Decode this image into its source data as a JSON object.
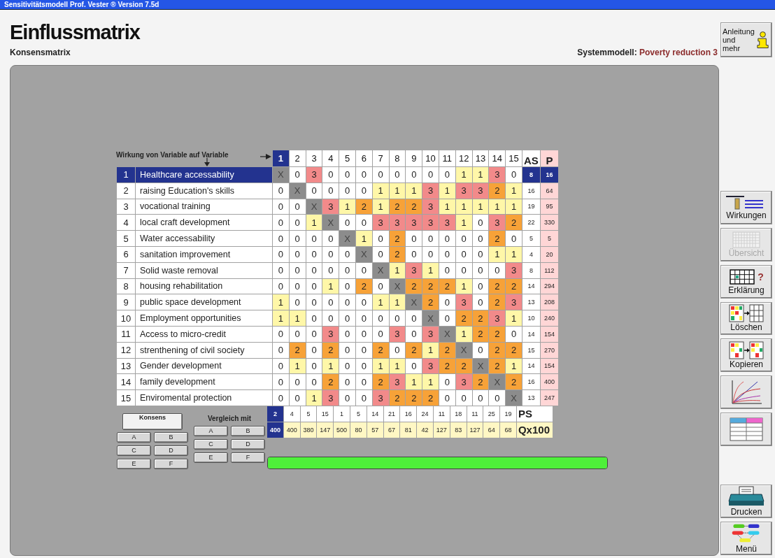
{
  "window": {
    "title": "Sensitivitätsmodell Prof. Vester ® Version 7.5d"
  },
  "header": {
    "title": "Einflussmatrix",
    "subtitle": "Konsensmatrix",
    "model_label": "Systemmodell:",
    "model_name": "Poverty reduction 3"
  },
  "matrix": {
    "caption": "Wirkung von Variable auf Variable",
    "as_label": "AS",
    "p_label": "P",
    "ps_label": "PS",
    "q_label": "Qx100",
    "columns": [
      {
        "label": "1",
        "selected": true
      },
      {
        "label": "2",
        "selected": false
      },
      {
        "label": "3",
        "selected": false
      },
      {
        "label": "4",
        "selected": false
      },
      {
        "label": "5",
        "selected": false
      },
      {
        "label": "6",
        "selected": false
      },
      {
        "label": "7",
        "selected": false
      },
      {
        "label": "8",
        "selected": false
      },
      {
        "label": "9",
        "selected": false
      },
      {
        "label": "10",
        "selected": false
      },
      {
        "label": "11",
        "selected": false
      },
      {
        "label": "12",
        "selected": false
      },
      {
        "label": "13",
        "selected": false
      },
      {
        "label": "14",
        "selected": false
      },
      {
        "label": "15",
        "selected": false
      }
    ],
    "rows": [
      {
        "number": "1",
        "name": "Healthcare accessability",
        "selected": true,
        "cells": [
          "X",
          "0",
          "3",
          "0",
          "0",
          "0",
          "0",
          "0",
          "0",
          "0",
          "0",
          "1",
          "1",
          "3",
          "0"
        ],
        "as": "8",
        "p": "16"
      },
      {
        "number": "2",
        "name": "raising Education's skills",
        "selected": false,
        "cells": [
          "0",
          "X",
          "0",
          "0",
          "0",
          "0",
          "1",
          "1",
          "1",
          "3",
          "1",
          "3",
          "3",
          "2",
          "1"
        ],
        "as": "16",
        "p": "64"
      },
      {
        "number": "3",
        "name": "vocational training",
        "selected": false,
        "cells": [
          "0",
          "0",
          "X",
          "3",
          "1",
          "2",
          "1",
          "2",
          "2",
          "3",
          "1",
          "1",
          "1",
          "1",
          "1"
        ],
        "as": "19",
        "p": "95"
      },
      {
        "number": "4",
        "name": "local craft development",
        "selected": false,
        "cells": [
          "0",
          "0",
          "1",
          "X",
          "0",
          "0",
          "3",
          "3",
          "3",
          "3",
          "3",
          "1",
          "0",
          "3",
          "2"
        ],
        "as": "22",
        "p": "330"
      },
      {
        "number": "5",
        "name": "Water accessability",
        "selected": false,
        "cells": [
          "0",
          "0",
          "0",
          "0",
          "X",
          "1",
          "0",
          "2",
          "0",
          "0",
          "0",
          "0",
          "0",
          "2",
          "0"
        ],
        "as": "5",
        "p": "5"
      },
      {
        "number": "6",
        "name": "sanitation improvement",
        "selected": false,
        "cells": [
          "0",
          "0",
          "0",
          "0",
          "0",
          "X",
          "0",
          "2",
          "0",
          "0",
          "0",
          "0",
          "0",
          "1",
          "1"
        ],
        "as": "4",
        "p": "20"
      },
      {
        "number": "7",
        "name": "Solid waste removal",
        "selected": false,
        "cells": [
          "0",
          "0",
          "0",
          "0",
          "0",
          "0",
          "X",
          "1",
          "3",
          "1",
          "0",
          "0",
          "0",
          "0",
          "3"
        ],
        "as": "8",
        "p": "112"
      },
      {
        "number": "8",
        "name": "housing rehabilitation",
        "selected": false,
        "cells": [
          "0",
          "0",
          "0",
          "1",
          "0",
          "2",
          "0",
          "X",
          "2",
          "2",
          "2",
          "1",
          "0",
          "2",
          "2"
        ],
        "as": "14",
        "p": "294"
      },
      {
        "number": "9",
        "name": "public space development",
        "selected": false,
        "cells": [
          "1",
          "0",
          "0",
          "0",
          "0",
          "0",
          "1",
          "1",
          "X",
          "2",
          "0",
          "3",
          "0",
          "2",
          "3"
        ],
        "as": "13",
        "p": "208"
      },
      {
        "number": "10",
        "name": "Employment opportunities",
        "selected": false,
        "cells": [
          "1",
          "1",
          "0",
          "0",
          "0",
          "0",
          "0",
          "0",
          "0",
          "X",
          "0",
          "2",
          "2",
          "3",
          "1"
        ],
        "as": "10",
        "p": "240"
      },
      {
        "number": "11",
        "name": "Access to micro-credit",
        "selected": false,
        "cells": [
          "0",
          "0",
          "0",
          "3",
          "0",
          "0",
          "0",
          "3",
          "0",
          "3",
          "X",
          "1",
          "2",
          "2",
          "0"
        ],
        "as": "14",
        "p": "154"
      },
      {
        "number": "12",
        "name": "strenthening of civil society",
        "selected": false,
        "cells": [
          "0",
          "2",
          "0",
          "2",
          "0",
          "0",
          "2",
          "0",
          "2",
          "1",
          "2",
          "X",
          "0",
          "2",
          "2"
        ],
        "as": "15",
        "p": "270"
      },
      {
        "number": "13",
        "name": "Gender development",
        "selected": false,
        "cells": [
          "0",
          "1",
          "0",
          "1",
          "0",
          "0",
          "1",
          "1",
          "0",
          "3",
          "2",
          "2",
          "X",
          "2",
          "1"
        ],
        "as": "14",
        "p": "154"
      },
      {
        "number": "14",
        "name": "family development",
        "selected": false,
        "cells": [
          "0",
          "0",
          "0",
          "2",
          "0",
          "0",
          "2",
          "3",
          "1",
          "1",
          "0",
          "3",
          "2",
          "X",
          "2"
        ],
        "as": "16",
        "p": "400"
      },
      {
        "number": "15",
        "name": "Enviromental protection",
        "selected": false,
        "cells": [
          "0",
          "0",
          "1",
          "3",
          "0",
          "0",
          "3",
          "2",
          "2",
          "2",
          "0",
          "0",
          "0",
          "0",
          "X"
        ],
        "as": "13",
        "p": "247"
      }
    ],
    "ps": [
      "2",
      "4",
      "5",
      "15",
      "1",
      "5",
      "14",
      "21",
      "16",
      "24",
      "11",
      "18",
      "11",
      "25",
      "19"
    ],
    "q": [
      "400",
      "400",
      "380",
      "147",
      "500",
      "80",
      "57",
      "67",
      "81",
      "42",
      "127",
      "83",
      "127",
      "64",
      "68"
    ]
  },
  "matrix_sets": {
    "own": {
      "label": "Konsens",
      "selected": true,
      "letters": [
        "A",
        "B",
        "C",
        "D",
        "E",
        "F"
      ]
    },
    "compare": {
      "label": "Vergleich mit",
      "letters": [
        "A",
        "B",
        "C",
        "D",
        "E",
        "F"
      ]
    }
  },
  "progress": {
    "level": 1
  },
  "sidebar": [
    {
      "kind": "info",
      "label": "Anleitung und mehr",
      "disabled": false
    },
    {
      "kind": "effects",
      "label": "Wirkungen",
      "disabled": false
    },
    {
      "kind": "overview",
      "label": "Übersicht",
      "disabled": true
    },
    {
      "kind": "explain",
      "mark": "?",
      "label": "Erklärung",
      "disabled": false
    },
    {
      "kind": "delete",
      "label": "Löschen",
      "disabled": false
    },
    {
      "kind": "copy",
      "label": "Kopieren",
      "disabled": false
    },
    {
      "kind": "chart",
      "disabled": false
    },
    {
      "kind": "table",
      "disabled": false
    },
    {
      "kind": "print",
      "label": "Drucken",
      "disabled": false
    },
    {
      "kind": "menu",
      "label": "Menü",
      "disabled": false
    }
  ]
}
